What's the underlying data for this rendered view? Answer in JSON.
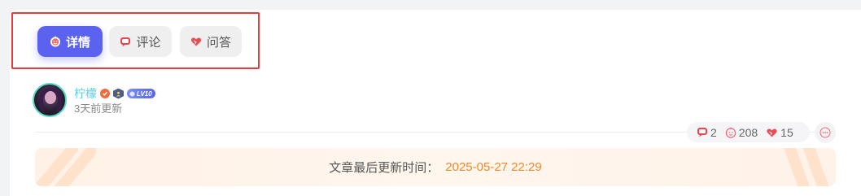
{
  "tabs": [
    {
      "label": "详情",
      "icon": "smiley-icon",
      "active": true
    },
    {
      "label": "评论",
      "icon": "comment-icon",
      "active": false
    },
    {
      "label": "问答",
      "icon": "heart-icon",
      "active": false
    }
  ],
  "author": {
    "name": "柠檬",
    "level": "LV10",
    "updated": "3天前更新"
  },
  "stats": {
    "comments": "2",
    "views": "208",
    "likes": "15"
  },
  "banner": {
    "label": "文章最后更新时间：",
    "value": "2025-05-27 22:29"
  },
  "colors": {
    "accent": "#5b62f0",
    "highlight_frame": "#e8393b",
    "date": "#f08a2b",
    "name": "#5ad0e6"
  }
}
